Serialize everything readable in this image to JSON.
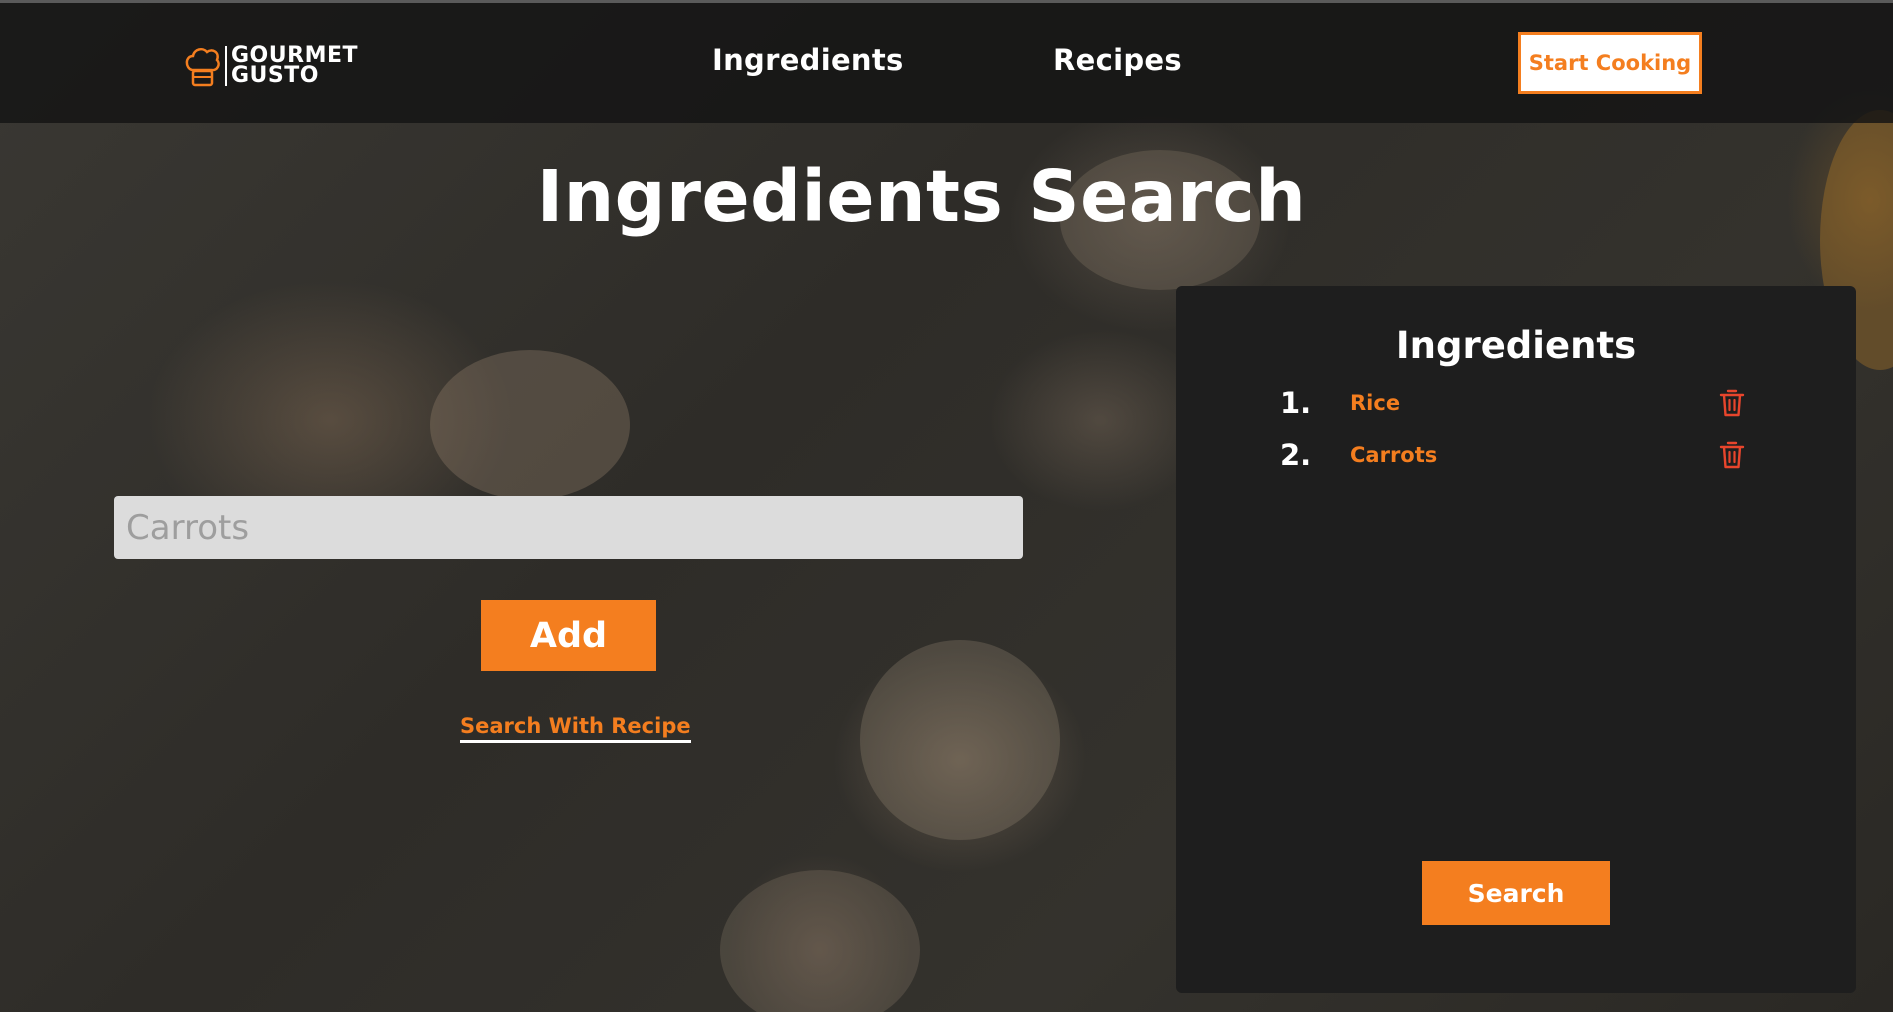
{
  "brand": {
    "line1": "GOURMET",
    "line2": "GUSTO"
  },
  "nav": {
    "ingredients_label": "Ingredients",
    "recipes_label": "Recipes",
    "start_cooking_label": "Start Cooking"
  },
  "main": {
    "title": "Ingredients Search",
    "search_input": {
      "placeholder": "Carrots",
      "value": ""
    },
    "add_label": "Add",
    "search_with_recipe_label": "Search With Recipe"
  },
  "panel": {
    "title": "Ingredients",
    "items": [
      {
        "number": "1.",
        "name": "Rice"
      },
      {
        "number": "2.",
        "name": "Carrots"
      }
    ],
    "search_label": "Search"
  },
  "colors": {
    "accent": "#f47e1f",
    "panel_bg": "#1e1e1e",
    "input_bg": "#dcdcdc"
  },
  "icons": {
    "logo": "chef-hat-icon",
    "delete": "trash-icon"
  }
}
